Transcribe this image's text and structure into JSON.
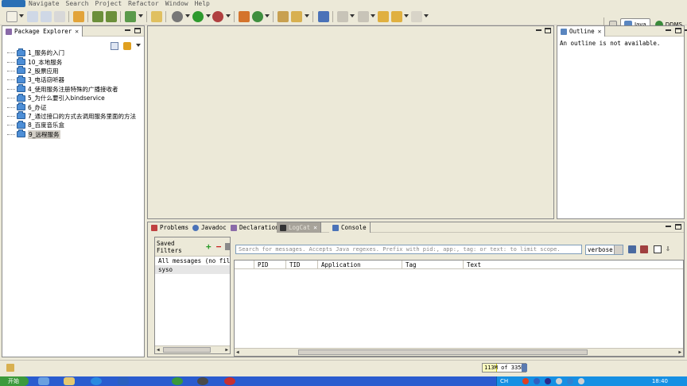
{
  "menu": [
    "Navigate",
    "Search",
    "Project",
    "Refactor",
    "Window",
    "Help"
  ],
  "perspectives": [
    {
      "label": "Java",
      "active": true
    },
    {
      "label": "DDMS",
      "active": false
    }
  ],
  "package_explorer": {
    "title": "Package Explorer",
    "items": [
      "1_服务的入门",
      "10_本地服务",
      "2_股票应用",
      "3_电话窃听器",
      "4_使用服务注册特殊的广播接收者",
      "5_为什么要引入bindservice",
      "6_办证",
      "7_通过接口的方式去调用服务里面的方法",
      "8_百度音乐盒",
      "9_远程服务"
    ],
    "selected_index": 9
  },
  "outline": {
    "title": "Outline",
    "message": "An outline is not available."
  },
  "bottom_tabs": [
    "Problems",
    "Javadoc",
    "Declaration",
    "LogCat",
    "Console"
  ],
  "logcat": {
    "saved_filters_label": "Saved Filters",
    "filters": [
      "All messages (no filters)",
      "syso"
    ],
    "selected_filter": 1,
    "search_placeholder": "Search for messages. Accepts Java regexes. Prefix with pid:, app:, tag: or text: to limit scope.",
    "level": "verbose",
    "columns": [
      "PID",
      "TID",
      "Application",
      "Tag",
      "Text"
    ]
  },
  "status": {
    "heap_used": "113M",
    "heap_of": "of",
    "heap_total": "335M",
    "heap_fraction": 0.34
  },
  "taskbar": {
    "start_label": "开始",
    "tray_lang": "CH",
    "clock": "18:40"
  }
}
